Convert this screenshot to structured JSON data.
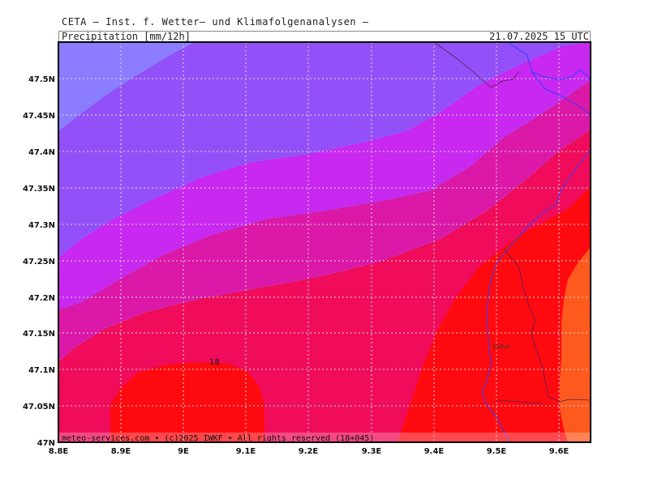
{
  "header": {
    "title": "CETA – Inst. f. Wetter– und Klimafolgenanalysen –",
    "parameter": "Precipitation [mm/12h]",
    "valid_time": "21.07.2025 15 UTC"
  },
  "map": {
    "lon_ticks": [
      "8.8E",
      "8.9E",
      "9E",
      "9.1E",
      "9.2E",
      "9.3E",
      "9.4E",
      "9.5E",
      "9.6E"
    ],
    "lat_ticks": [
      "47.5N",
      "47.45N",
      "47.4N",
      "47.35N",
      "47.3N",
      "47.25N",
      "47.2N",
      "47.15N",
      "47.1N",
      "47.05N",
      "47N"
    ],
    "contour_label": "18",
    "place_label": "Vaduz",
    "credit": "meteo-services.com • (c)2025 IWKF • All rights reserved (18+045)",
    "colors": {
      "band_lightest": "#8c7cff",
      "band_violet": "#9450f8",
      "band_purple": "#c828f0",
      "band_magenta": "#dc18a8",
      "band_crimson": "#f00c5a",
      "band_red": "#ff0a10",
      "band_orange": "#ff5a1e",
      "borders": "#3a3aff",
      "grid": "#dcdcdc"
    }
  }
}
